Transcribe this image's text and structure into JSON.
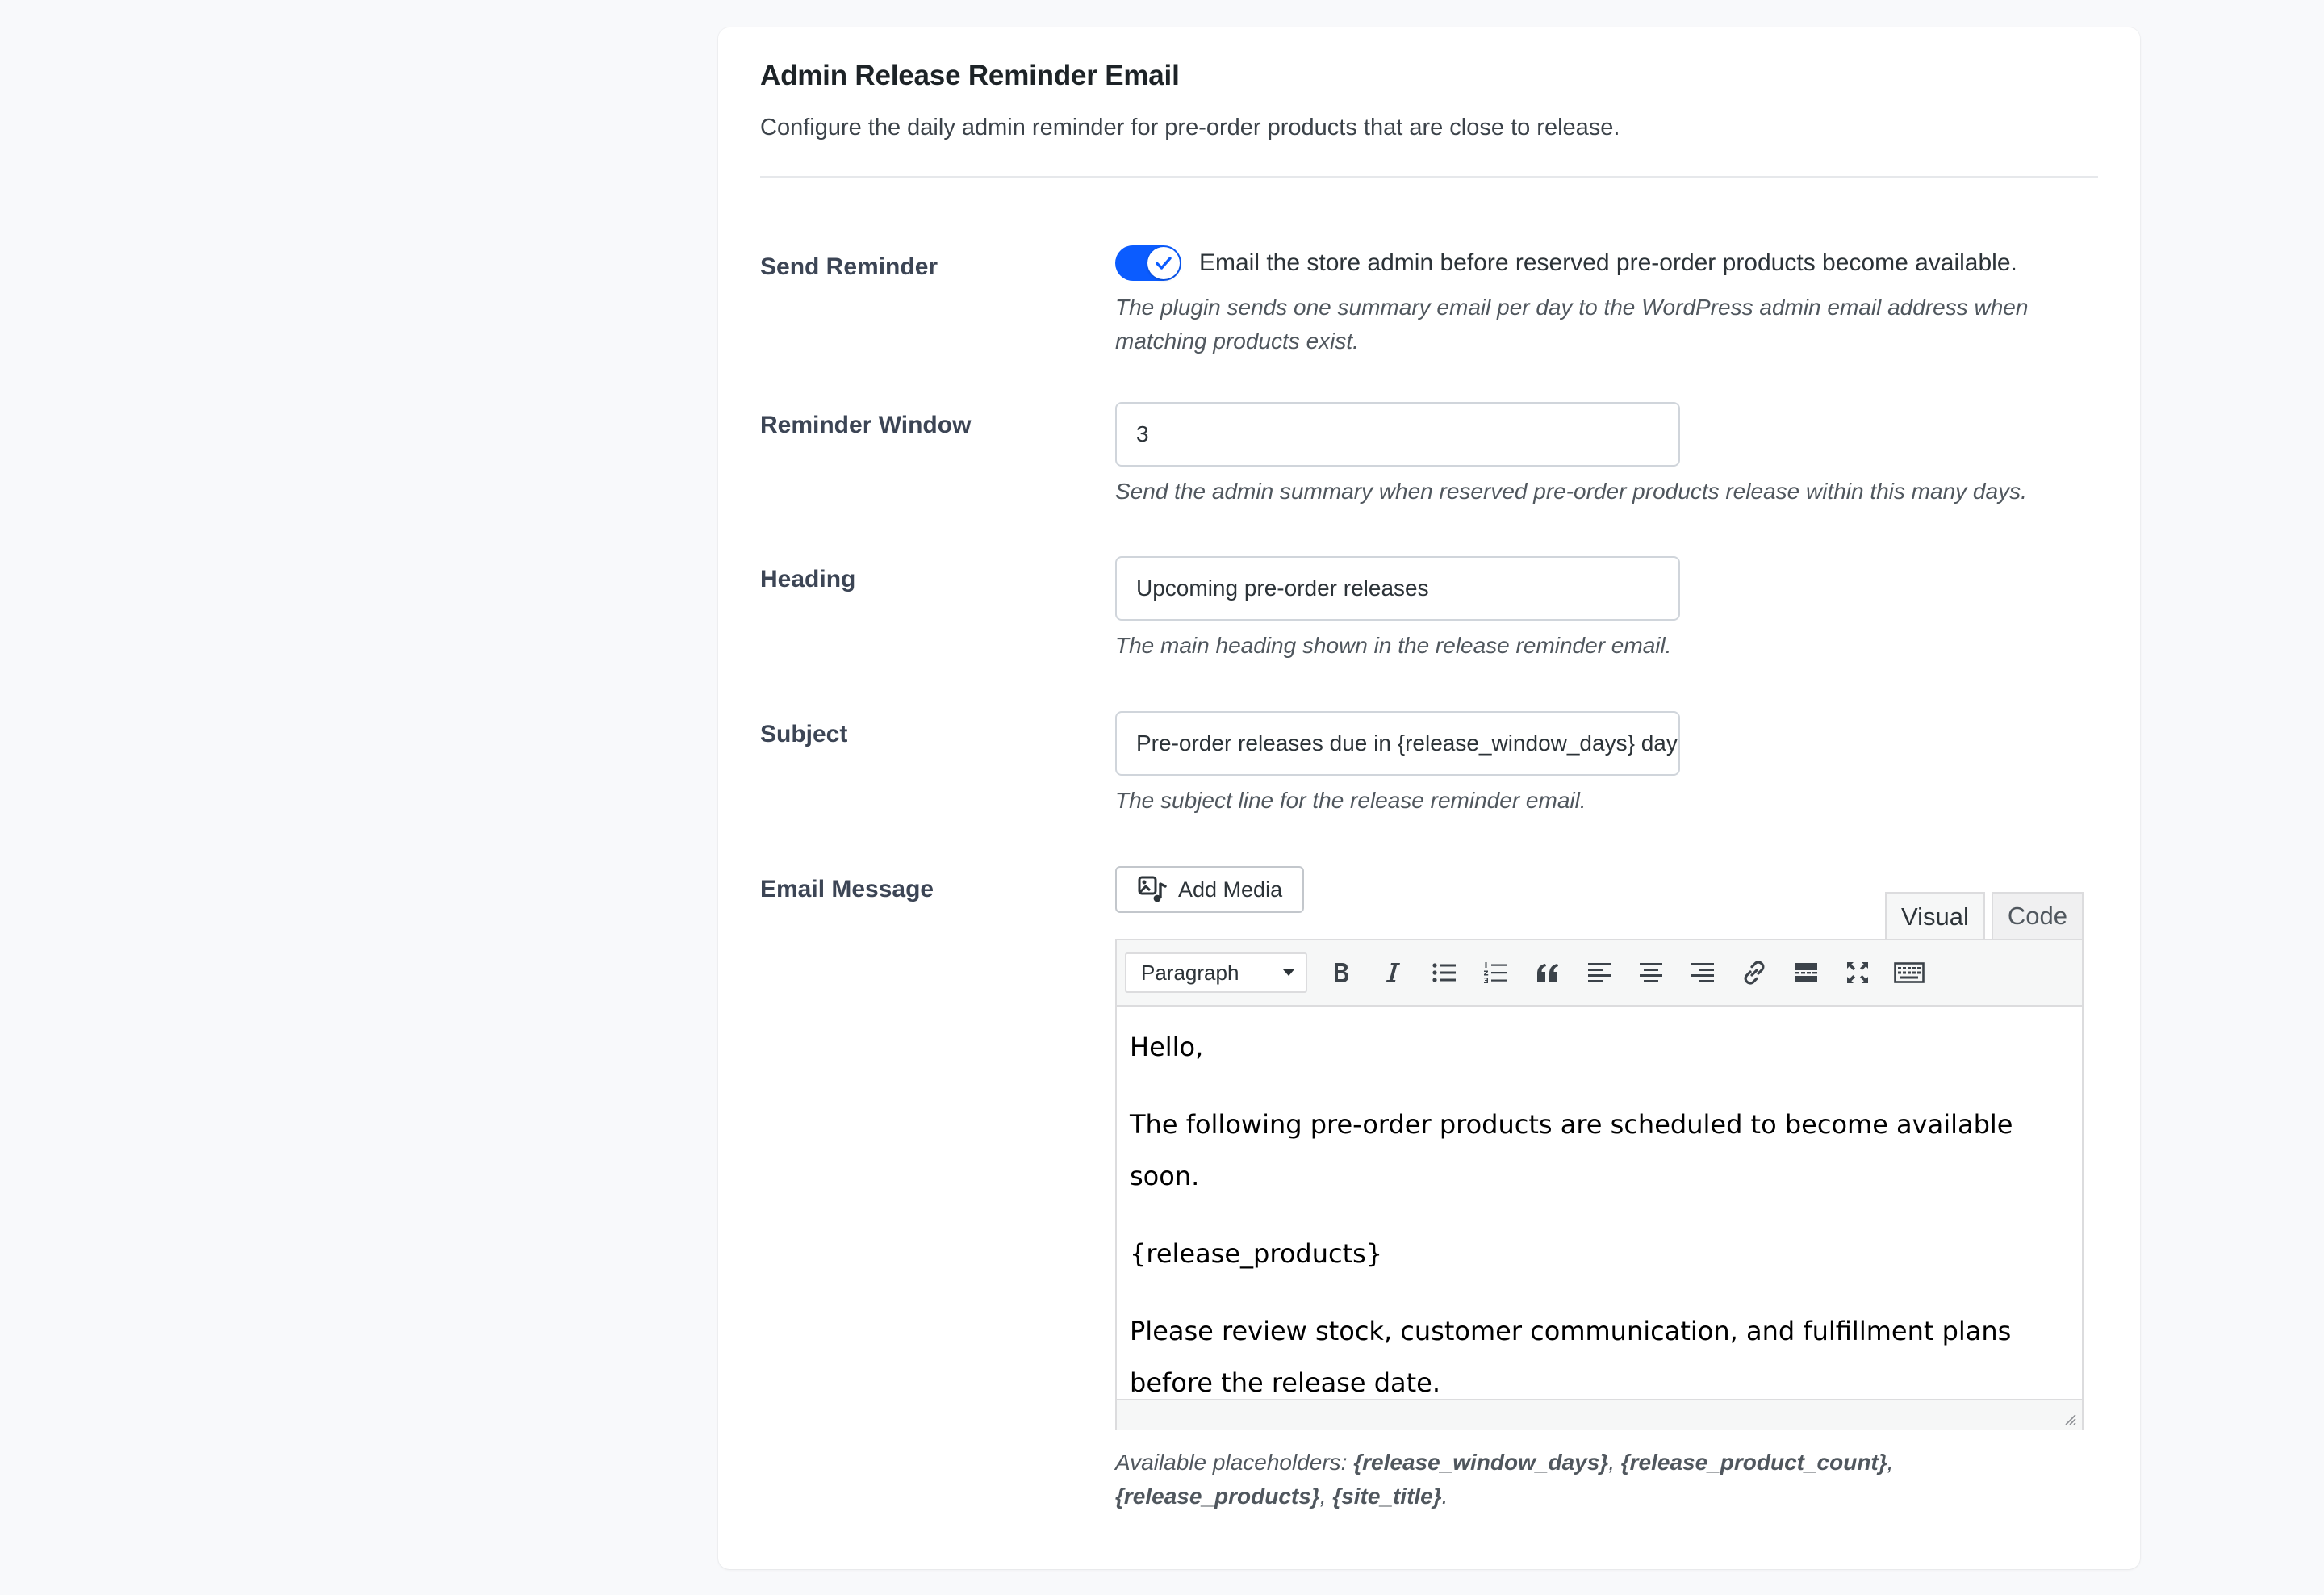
{
  "section": {
    "title": "Admin Release Reminder Email",
    "description": "Configure the daily admin reminder for pre-order products that are close to release."
  },
  "send_reminder": {
    "label": "Send Reminder",
    "toggle_on": true,
    "toggle_text": "Email the store admin before reserved pre-order products become available.",
    "help": "The plugin sends one summary email per day to the WordPress admin email address when matching products exist."
  },
  "reminder_window": {
    "label": "Reminder Window",
    "value": "3",
    "help": "Send the admin summary when reserved pre-order products release within this many days."
  },
  "heading": {
    "label": "Heading",
    "value": "Upcoming pre-order releases",
    "help": "The main heading shown in the release reminder email."
  },
  "subject": {
    "label": "Subject",
    "value": "Pre-order releases due in {release_window_days} days",
    "help": "The subject line for the release reminder email."
  },
  "email_message": {
    "label": "Email Message",
    "add_media_label": "Add Media",
    "tabs": [
      {
        "label": "Visual",
        "active": true
      },
      {
        "label": "Code",
        "active": false
      }
    ],
    "format_select": "Paragraph",
    "toolbar_icons": [
      "bold-icon",
      "italic-icon",
      "bullet-list-icon",
      "numbered-list-icon",
      "blockquote-icon",
      "align-left-icon",
      "align-center-icon",
      "align-right-icon",
      "link-icon",
      "read-more-icon",
      "fullscreen-icon",
      "toolbar-toggle-icon"
    ],
    "paragraphs": [
      "Hello,",
      "The following pre-order products are scheduled to become available soon.",
      "{release_products}",
      "Please review stock, customer communication, and fulfillment plans before the release date."
    ],
    "placeholders_intro": "Available placeholders: ",
    "placeholders": [
      "{release_window_days}",
      "{release_product_count}",
      "{release_products}",
      "{site_title}"
    ]
  },
  "colors": {
    "accent": "#0b5cff"
  }
}
